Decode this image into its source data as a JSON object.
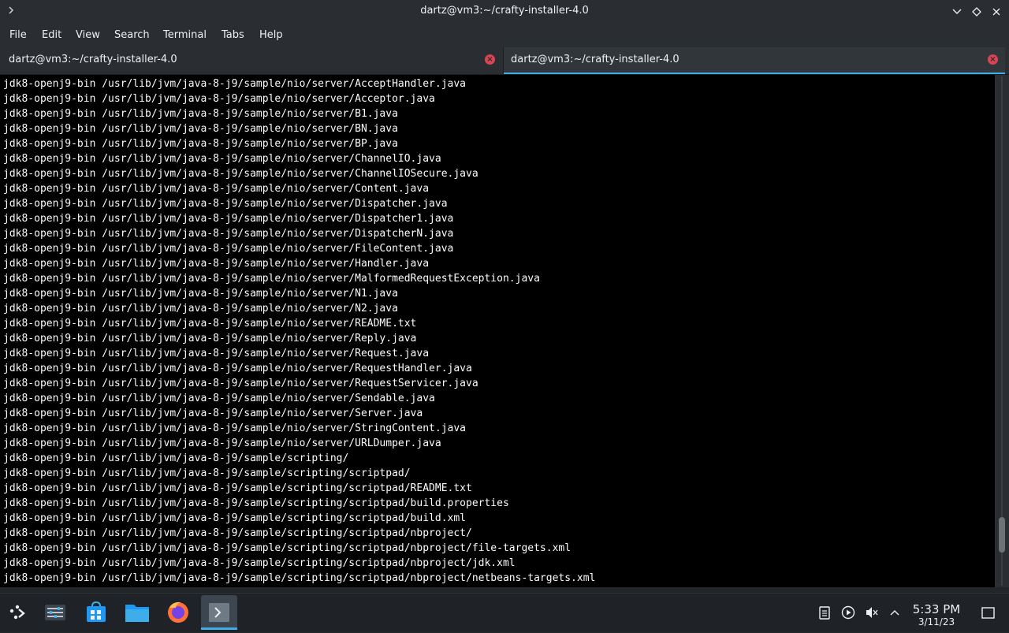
{
  "window": {
    "title": "dartz@vm3:~/crafty-installer-4.0",
    "app_icon": "terminal-prompt-icon",
    "controls": {
      "minimize": "chevron-down-icon",
      "maximize": "diamond-icon",
      "close": "close-icon"
    }
  },
  "menu": [
    "File",
    "Edit",
    "View",
    "Search",
    "Terminal",
    "Tabs",
    "Help"
  ],
  "tabs": [
    {
      "label": "dartz@vm3:~/crafty-installer-4.0",
      "active": false
    },
    {
      "label": "dartz@vm3:~/crafty-installer-4.0",
      "active": true
    }
  ],
  "terminal": {
    "lines": [
      "jdk8-openj9-bin /usr/lib/jvm/java-8-j9/sample/nio/server/AcceptHandler.java",
      "jdk8-openj9-bin /usr/lib/jvm/java-8-j9/sample/nio/server/Acceptor.java",
      "jdk8-openj9-bin /usr/lib/jvm/java-8-j9/sample/nio/server/B1.java",
      "jdk8-openj9-bin /usr/lib/jvm/java-8-j9/sample/nio/server/BN.java",
      "jdk8-openj9-bin /usr/lib/jvm/java-8-j9/sample/nio/server/BP.java",
      "jdk8-openj9-bin /usr/lib/jvm/java-8-j9/sample/nio/server/ChannelIO.java",
      "jdk8-openj9-bin /usr/lib/jvm/java-8-j9/sample/nio/server/ChannelIOSecure.java",
      "jdk8-openj9-bin /usr/lib/jvm/java-8-j9/sample/nio/server/Content.java",
      "jdk8-openj9-bin /usr/lib/jvm/java-8-j9/sample/nio/server/Dispatcher.java",
      "jdk8-openj9-bin /usr/lib/jvm/java-8-j9/sample/nio/server/Dispatcher1.java",
      "jdk8-openj9-bin /usr/lib/jvm/java-8-j9/sample/nio/server/DispatcherN.java",
      "jdk8-openj9-bin /usr/lib/jvm/java-8-j9/sample/nio/server/FileContent.java",
      "jdk8-openj9-bin /usr/lib/jvm/java-8-j9/sample/nio/server/Handler.java",
      "jdk8-openj9-bin /usr/lib/jvm/java-8-j9/sample/nio/server/MalformedRequestException.java",
      "jdk8-openj9-bin /usr/lib/jvm/java-8-j9/sample/nio/server/N1.java",
      "jdk8-openj9-bin /usr/lib/jvm/java-8-j9/sample/nio/server/N2.java",
      "jdk8-openj9-bin /usr/lib/jvm/java-8-j9/sample/nio/server/README.txt",
      "jdk8-openj9-bin /usr/lib/jvm/java-8-j9/sample/nio/server/Reply.java",
      "jdk8-openj9-bin /usr/lib/jvm/java-8-j9/sample/nio/server/Request.java",
      "jdk8-openj9-bin /usr/lib/jvm/java-8-j9/sample/nio/server/RequestHandler.java",
      "jdk8-openj9-bin /usr/lib/jvm/java-8-j9/sample/nio/server/RequestServicer.java",
      "jdk8-openj9-bin /usr/lib/jvm/java-8-j9/sample/nio/server/Sendable.java",
      "jdk8-openj9-bin /usr/lib/jvm/java-8-j9/sample/nio/server/Server.java",
      "jdk8-openj9-bin /usr/lib/jvm/java-8-j9/sample/nio/server/StringContent.java",
      "jdk8-openj9-bin /usr/lib/jvm/java-8-j9/sample/nio/server/URLDumper.java",
      "jdk8-openj9-bin /usr/lib/jvm/java-8-j9/sample/scripting/",
      "jdk8-openj9-bin /usr/lib/jvm/java-8-j9/sample/scripting/scriptpad/",
      "jdk8-openj9-bin /usr/lib/jvm/java-8-j9/sample/scripting/scriptpad/README.txt",
      "jdk8-openj9-bin /usr/lib/jvm/java-8-j9/sample/scripting/scriptpad/build.properties",
      "jdk8-openj9-bin /usr/lib/jvm/java-8-j9/sample/scripting/scriptpad/build.xml",
      "jdk8-openj9-bin /usr/lib/jvm/java-8-j9/sample/scripting/scriptpad/nbproject/",
      "jdk8-openj9-bin /usr/lib/jvm/java-8-j9/sample/scripting/scriptpad/nbproject/file-targets.xml",
      "jdk8-openj9-bin /usr/lib/jvm/java-8-j9/sample/scripting/scriptpad/nbproject/jdk.xml",
      "jdk8-openj9-bin /usr/lib/jvm/java-8-j9/sample/scripting/scriptpad/nbproject/netbeans-targets.xml"
    ],
    "scroll_position": 0.93,
    "scroll_visible_fraction": 0.07
  },
  "taskbar": {
    "items": [
      {
        "name": "application-launcher",
        "icon": "kde-launcher-icon",
        "active": false
      },
      {
        "name": "system-settings",
        "icon": "sliders-icon",
        "active": false
      },
      {
        "name": "discover-store",
        "icon": "shopping-bag-icon",
        "active": false
      },
      {
        "name": "dolphin-file-manager",
        "icon": "folder-icon",
        "active": false
      },
      {
        "name": "firefox",
        "icon": "firefox-icon",
        "active": false
      },
      {
        "name": "konsole",
        "icon": "terminal-icon",
        "active": true
      }
    ],
    "tray": [
      "clipboard-icon",
      "media-play-icon",
      "volume-muted-icon",
      "chevron-up-icon"
    ],
    "clock": {
      "time": "5:33 PM",
      "date": "3/11/23"
    },
    "show_desktop": "show-desktop-icon"
  },
  "colors": {
    "accent": "#3daee9",
    "close_red": "#da4453",
    "terminal_bg": "#000000",
    "terminal_fg": "#fcfcfc",
    "chrome_bg": "#2a2e32"
  }
}
